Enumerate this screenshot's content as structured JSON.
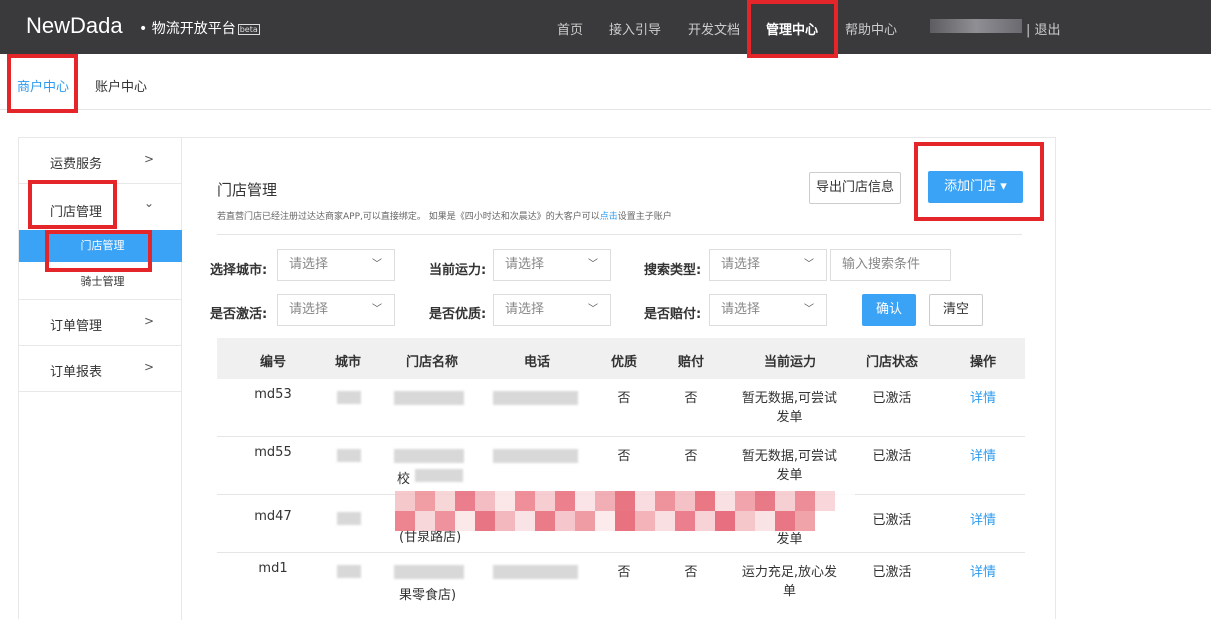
{
  "header": {
    "logo": "NewDada",
    "platform": "• 物流开放平台",
    "beta": "beta",
    "nav": [
      "首页",
      "接入引导",
      "开发文档",
      "管理中心",
      "帮助中心"
    ],
    "logout": "| 退出"
  },
  "subnav": {
    "tabs": [
      "商户中心",
      "账户中心"
    ]
  },
  "sidebar": {
    "items": [
      {
        "label": "运费服务",
        "chevron": ">"
      },
      {
        "label": "门店管理",
        "chevron": "⌄"
      },
      {
        "label": "订单管理",
        "chevron": ">"
      },
      {
        "label": "订单报表",
        "chevron": ">"
      }
    ],
    "subitems": [
      "门店管理",
      "骑士管理"
    ]
  },
  "main": {
    "title": "门店管理",
    "note_before": "若直营门店已经注册过达达商家APP,可以直接绑定。 如果是《四小时达和次晨达》的大客户可以",
    "note_link": "点击",
    "note_after": "设置主子账户",
    "export_button": "导出门店信息",
    "add_button": "添加门店 ▾"
  },
  "filters": {
    "city_label": "选择城市:",
    "capacity_label": "当前运力:",
    "search_type_label": "搜索类型:",
    "activated_label": "是否激活:",
    "quality_label": "是否优质:",
    "compensate_label": "是否赔付:",
    "placeholder": "请选择",
    "search_placeholder": "输入搜索条件",
    "confirm": "确认",
    "clear": "清空"
  },
  "table": {
    "headers": [
      "编号",
      "城市",
      "门店名称",
      "电话",
      "优质",
      "赔付",
      "当前运力",
      "门店状态",
      "操作"
    ],
    "rows": [
      {
        "id": "md53",
        "name_tail": "",
        "quality": "否",
        "compensate": "否",
        "capacity": [
          "暂无数据,可尝试",
          "发单"
        ],
        "status": "已激活",
        "action": "详情"
      },
      {
        "id": "md55",
        "name_tail": "校",
        "quality": "否",
        "compensate": "否",
        "capacity": [
          "暂无数据,可尝试",
          "发单"
        ],
        "status": "已激活",
        "action": "详情"
      },
      {
        "id": "md47",
        "name_tail": "(甘泉路店)",
        "quality": "",
        "compensate": "",
        "capacity": [
          "",
          "发单"
        ],
        "status": "已激活",
        "action": "详情"
      },
      {
        "id": "md1",
        "name_tail": "果零食店)",
        "quality": "否",
        "compensate": "否",
        "capacity": [
          "运力充足,放心发",
          "单"
        ],
        "status": "已激活",
        "action": "详情"
      }
    ]
  },
  "colors": {
    "accent": "#3ba3f6",
    "topbar": "#3a3a3d",
    "highlight": "#e4262a"
  }
}
